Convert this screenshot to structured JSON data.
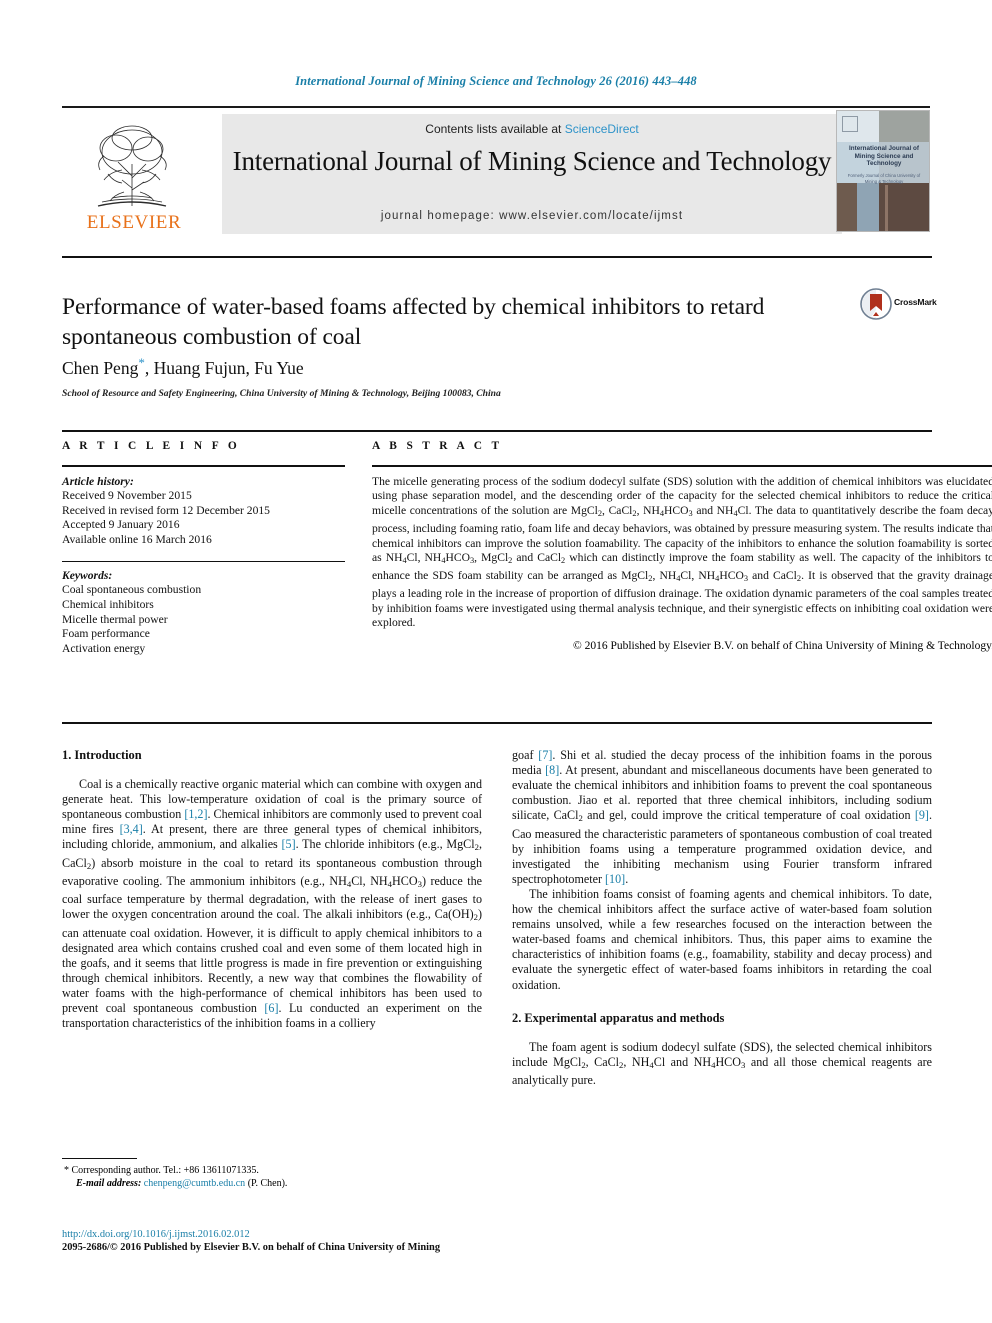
{
  "running_head": "International Journal of Mining Science and Technology 26 (2016) 443–448",
  "masthead": {
    "contents_prefix": "Contents lists available at ",
    "sciencedirect": "ScienceDirect",
    "journal_name": "International Journal of Mining Science and Technology",
    "homepage": "journal homepage: www.elsevier.com/locate/ijmst",
    "publisher_wordmark": "ELSEVIER",
    "cover_title": "International Journal of Mining Science and Technology",
    "cover_subtitle": "Formerly Journal of China University of Mining & Technology"
  },
  "article": {
    "title": "Performance of water-based foams affected by chemical inhibitors to retard spontaneous combustion of coal",
    "authors": "Chen Peng*, Huang Fujun, Fu Yue",
    "authors_plain": "Chen Peng",
    "authors_rest": ", Huang Fujun, Fu Yue",
    "affiliation": "School of Resource and Safety Engineering, China University of Mining & Technology, Beijing 100083, China",
    "crossmark_label": "CrossMark"
  },
  "info": {
    "heading": "A R T I C L E   I N F O",
    "history_label": "Article history:",
    "history": [
      "Received 9 November 2015",
      "Received in revised form 12 December 2015",
      "Accepted 9 January 2016",
      "Available online 16 March 2016"
    ],
    "keywords_label": "Keywords:",
    "keywords": [
      "Coal spontaneous combustion",
      "Chemical inhibitors",
      "Micelle thermal power",
      "Foam performance",
      "Activation energy"
    ]
  },
  "abstract": {
    "heading": "A B S T R A C T",
    "paragraph_html": "The micelle generating process of the sodium dodecyl sulfate (SDS) solution with the addition of chemical inhibitors was elucidated using phase separation model, and the descending order of the capacity for the selected chemical inhibitors to reduce the critical micelle concentrations of the solution are MgCl<sub>2</sub>, CaCl<sub>2</sub>, NH<sub>4</sub>HCO<sub>3</sub> and NH<sub>4</sub>Cl. The data to quantitatively describe the foam decay process, including foaming ratio, foam life and decay behaviors, was obtained by pressure measuring system. The results indicate that chemical inhibitors can improve the solution foamability. The capacity of the inhibitors to enhance the solution foamability is sorted as NH<sub>4</sub>Cl, NH<sub>4</sub>HCO<sub>3</sub>, MgCl<sub>2</sub> and CaCl<sub>2</sub> which can distinctly improve the foam stability as well. The capacity of the inhibitors to enhance the SDS foam stability can be arranged as MgCl<sub>2</sub>, NH<sub>4</sub>Cl, NH<sub>4</sub>HCO<sub>3</sub> and CaCl<sub>2</sub>. It is observed that the gravity drainage plays a leading role in the increase of proportion of diffusion drainage. The oxidation dynamic parameters of the coal samples treated by inhibition foams were investigated using thermal analysis technique, and their synergistic effects on inhibiting coal oxidation were explored.",
    "copyright": "© 2016 Published by Elsevier B.V. on behalf of China University of Mining & Technology."
  },
  "sections": {
    "intro_heading": "1. Introduction",
    "intro_p1_html": "Coal is a chemically reactive organic material which can combine with oxygen and generate heat. This low-temperature oxidation of coal is the primary source of spontaneous combustion <span class=\"ref\">[1,2]</span>. Chemical inhibitors are commonly used to prevent coal mine fires <span class=\"ref\">[3,4]</span>. At present, there are three general types of chemical inhibitors, including chloride, ammonium, and alkalies <span class=\"ref\">[5]</span>. The chloride inhibitors (e.g., MgCl<sub>2</sub>, CaCl<sub>2</sub>) absorb moisture in the coal to retard its spontaneous combustion through evaporative cooling. The ammonium inhibitors (e.g., NH<sub>4</sub>Cl, NH<sub>4</sub>HCO<sub>3</sub>) reduce the coal surface temperature by thermal degradation, with the release of inert gases to lower the oxygen concentration around the coal. The alkali inhibitors (e.g., Ca(OH)<sub>2</sub>) can attenuate coal oxidation. However, it is difficult to apply chemical inhibitors to a designated area which contains crushed coal and even some of them located high in the goafs, and it seems that little progress is made in fire prevention or extinguishing through chemical inhibitors. Recently, a new way that combines the flowability of water foams with the high-performance of chemical inhibitors has been used to prevent coal spontaneous combustion <span class=\"ref\">[6]</span>. Lu conducted an experiment on the transportation characteristics of the inhibition foams in a colliery",
    "intro_p1_cont_html": "goaf <span class=\"ref\">[7]</span>. Shi et al. studied the decay process of the inhibition foams in the porous media <span class=\"ref\">[8]</span>. At present, abundant and miscellaneous documents have been generated to evaluate the chemical inhibitors and inhibition foams to prevent the coal spontaneous combustion. Jiao et al. reported that three chemical inhibitors, including sodium silicate, CaCl<sub>2</sub> and gel, could improve the critical temperature of coal oxidation <span class=\"ref\">[9]</span>. Cao measured the characteristic parameters of spontaneous combustion of coal treated by inhibition foams using a temperature programmed oxidation device, and investigated the inhibiting mechanism using Fourier transform infrared spectrophotometer <span class=\"ref\">[10]</span>.",
    "intro_p2_html": "The inhibition foams consist of foaming agents and chemical inhibitors. To date, how the chemical inhibitors affect the surface active of water-based foam solution remains unsolved, while a few researches focused on the interaction between the water-based foams and chemical inhibitors. Thus, this paper aims to examine the characteristics of inhibition foams (e.g., foamability, stability and decay process) and evaluate the synergetic effect of water-based foams inhibitors in retarding the coal oxidation.",
    "exp_heading": "2. Experimental apparatus and methods",
    "exp_p1_html": "The foam agent is sodium dodecyl sulfate (SDS), the selected chemical inhibitors include MgCl<sub>2</sub>, CaCl<sub>2</sub>, NH<sub>4</sub>Cl and NH<sub>4</sub>HCO<sub>3</sub> and all those chemical reagents are analytically pure."
  },
  "footnote": {
    "corresponding": "* Corresponding author. Tel.: +86 13611071335.",
    "email_label": "E-mail address:",
    "email": "chenpeng@cumtb.edu.cn",
    "email_owner": "(P. Chen)."
  },
  "page_footer": {
    "doi": "http://dx.doi.org/10.1016/j.ijmst.2016.02.012",
    "issn_copyright": "2095-2686/© 2016 Published by Elsevier B.V. on behalf of China University of Mining"
  },
  "colors": {
    "link_blue": "#1a7fa8",
    "sciencedirect_blue": "#2e93c9",
    "elsevier_orange": "#e8711a",
    "crossmark_red": "#b0301c"
  }
}
